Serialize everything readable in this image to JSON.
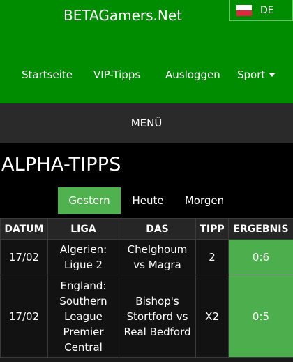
{
  "header": {
    "brand": "BETAGamers.Net",
    "language": "DE",
    "language_flag_icon": "flag-germany-icon"
  },
  "nav": {
    "items": [
      "Startseite",
      "VIP-Tipps",
      "Ausloggen",
      "Sport"
    ],
    "dropdown_icon": "caret-down-icon"
  },
  "menu": {
    "label": "MENÜ"
  },
  "page": {
    "title": "ALPHA-TIPPS"
  },
  "tabs": [
    {
      "label": "Gestern",
      "active": true
    },
    {
      "label": "Heute",
      "active": false
    },
    {
      "label": "Morgen",
      "active": false
    }
  ],
  "table": {
    "headers": [
      "DATUM",
      "LIGA",
      "DAS",
      "TIPP",
      "ERGEBNIS"
    ],
    "rows": [
      {
        "date": "17/02",
        "league": [
          "Algerien:",
          "Ligue 2"
        ],
        "match": [
          "Chelghoum",
          "vs Magra"
        ],
        "tip": "2",
        "result": "0:6"
      },
      {
        "date": "17/02",
        "league": [
          "England:",
          "Southern",
          "League",
          "Premier",
          "Central"
        ],
        "match": [
          "Bishop's",
          "Stortford vs",
          "Real Bedford"
        ],
        "tip": "X2",
        "result": "0:5"
      }
    ]
  },
  "colors": {
    "header_green": "#008c00",
    "active_tab_green": "#4fb24f",
    "result_green": "#4cae4c",
    "menu_bar": "#2a2a2a",
    "background": "#000000"
  }
}
